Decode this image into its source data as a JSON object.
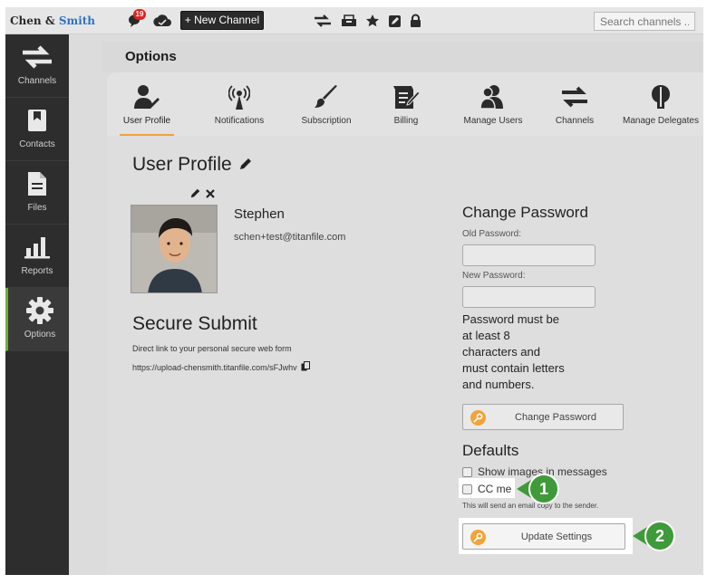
{
  "brand": {
    "part1": "Chen & ",
    "part2": "Smith"
  },
  "topbar": {
    "notification_count": "19",
    "new_channel_label": "+ New Channel",
    "search_placeholder": "Search channels ..."
  },
  "sidebar": {
    "items": [
      {
        "label": "Channels",
        "icon": "channels-icon"
      },
      {
        "label": "Contacts",
        "icon": "contacts-icon"
      },
      {
        "label": "Files",
        "icon": "files-icon"
      },
      {
        "label": "Reports",
        "icon": "reports-icon"
      },
      {
        "label": "Options",
        "icon": "gear-icon",
        "active": true
      }
    ]
  },
  "page": {
    "title": "Options"
  },
  "tabs": [
    {
      "label": "User Profile",
      "icon": "user-edit-icon",
      "active": true
    },
    {
      "label": "Notifications",
      "icon": "antenna-icon"
    },
    {
      "label": "Subscription",
      "icon": "brush-icon"
    },
    {
      "label": "Billing",
      "icon": "invoice-edit-icon"
    },
    {
      "label": "Manage Users",
      "icon": "users-icon"
    },
    {
      "label": "Channels",
      "icon": "channels-icon"
    },
    {
      "label": "Manage Delegates",
      "icon": "delegates-icon"
    }
  ],
  "profile": {
    "heading": "User Profile",
    "name": "Stephen",
    "email": "schen+test@titanfile.com"
  },
  "secure_submit": {
    "title": "Secure Submit",
    "description": "Direct link to your personal secure web form",
    "link": "https://upload-chensmith.titanfile.com/sFJwhv"
  },
  "change_password": {
    "title": "Change Password",
    "old_label": "Old Password:",
    "new_label": "New Password:",
    "hint_lines": [
      "Password must be",
      "at least 8",
      "characters and",
      "must contain letters",
      "and numbers."
    ],
    "button_label": "Change Password"
  },
  "defaults": {
    "title": "Defaults",
    "show_images_label": "Show images in messages",
    "cc_me_label": "CC me",
    "cc_note": "This will send an email copy to the sender.",
    "update_label": "Update Settings"
  },
  "callouts": {
    "one": "1",
    "two": "2"
  },
  "colors": {
    "accent_orange": "#f0a23a",
    "callout_green": "#3f9a3a",
    "sidebar_bg": "#2d2d2d",
    "brand_blue": "#2f72c4"
  }
}
